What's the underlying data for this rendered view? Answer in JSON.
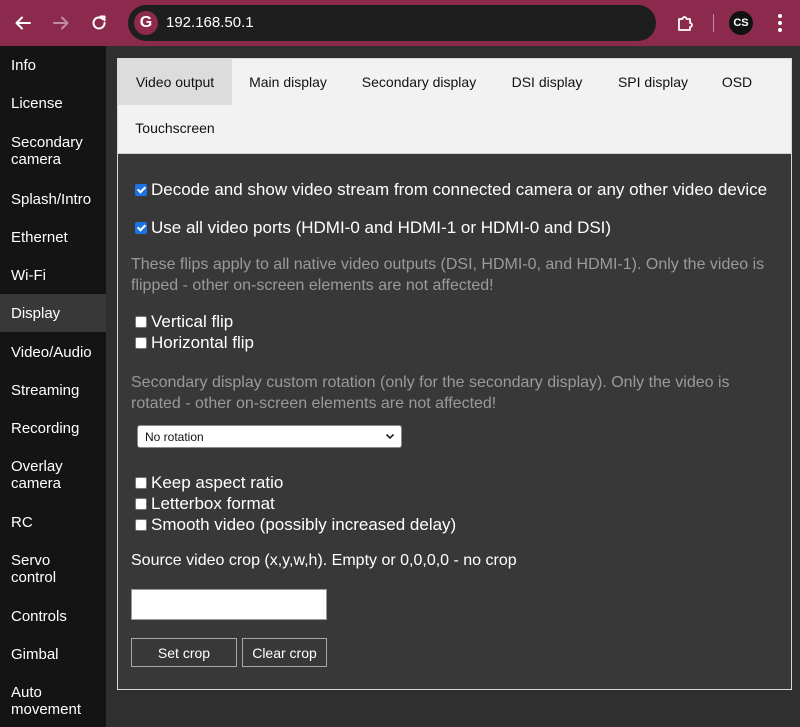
{
  "browser": {
    "url": "192.168.50.1",
    "site_icon_letter": "G",
    "profile_initials": "CS",
    "accent_color": "#8b2a4d"
  },
  "sidebar": {
    "items": [
      {
        "label": "Info"
      },
      {
        "label": "License"
      },
      {
        "label": "Secondary camera"
      },
      {
        "label": "Splash/Intro"
      },
      {
        "label": "Ethernet"
      },
      {
        "label": "Wi-Fi"
      },
      {
        "label": "Display",
        "active": true
      },
      {
        "label": "Video/Audio"
      },
      {
        "label": "Streaming"
      },
      {
        "label": "Recording"
      },
      {
        "label": "Overlay camera"
      },
      {
        "label": "RC"
      },
      {
        "label": "Servo control"
      },
      {
        "label": "Controls"
      },
      {
        "label": "Gimbal"
      },
      {
        "label": "Auto movement"
      }
    ]
  },
  "tabs": [
    {
      "label": "Video output",
      "active": true
    },
    {
      "label": "Main display"
    },
    {
      "label": "Secondary display"
    },
    {
      "label": "DSI display"
    },
    {
      "label": "SPI display"
    },
    {
      "label": "OSD"
    },
    {
      "label": "Touchscreen"
    }
  ],
  "video_output": {
    "decode_stream": {
      "label": "Decode and show video stream from connected camera or any other video device",
      "checked": true
    },
    "use_all_ports": {
      "label": "Use all video ports (HDMI-0 and HDMI-1 or HDMI-0 and DSI)",
      "checked": true
    },
    "flip_note": "These flips apply to all native video outputs (DSI, HDMI-0, and HDMI-1). Only the video is flipped - other on-screen elements are not affected!",
    "vertical_flip": {
      "label": "Vertical flip",
      "checked": false
    },
    "horizontal_flip": {
      "label": "Horizontal flip",
      "checked": false
    },
    "rotation_note": "Secondary display custom rotation (only for the secondary display). Only the video is rotated - other on-screen elements are not affected!",
    "rotation_selected": "No rotation",
    "keep_aspect": {
      "label": "Keep aspect ratio",
      "checked": false
    },
    "letterbox": {
      "label": "Letterbox format",
      "checked": false
    },
    "smooth_video": {
      "label": "Smooth video (possibly increased delay)",
      "checked": false
    },
    "crop_label": "Source video crop (x,y,w,h). Empty or 0,0,0,0 - no crop",
    "crop_value": "",
    "set_crop": "Set crop",
    "clear_crop": "Clear crop"
  }
}
